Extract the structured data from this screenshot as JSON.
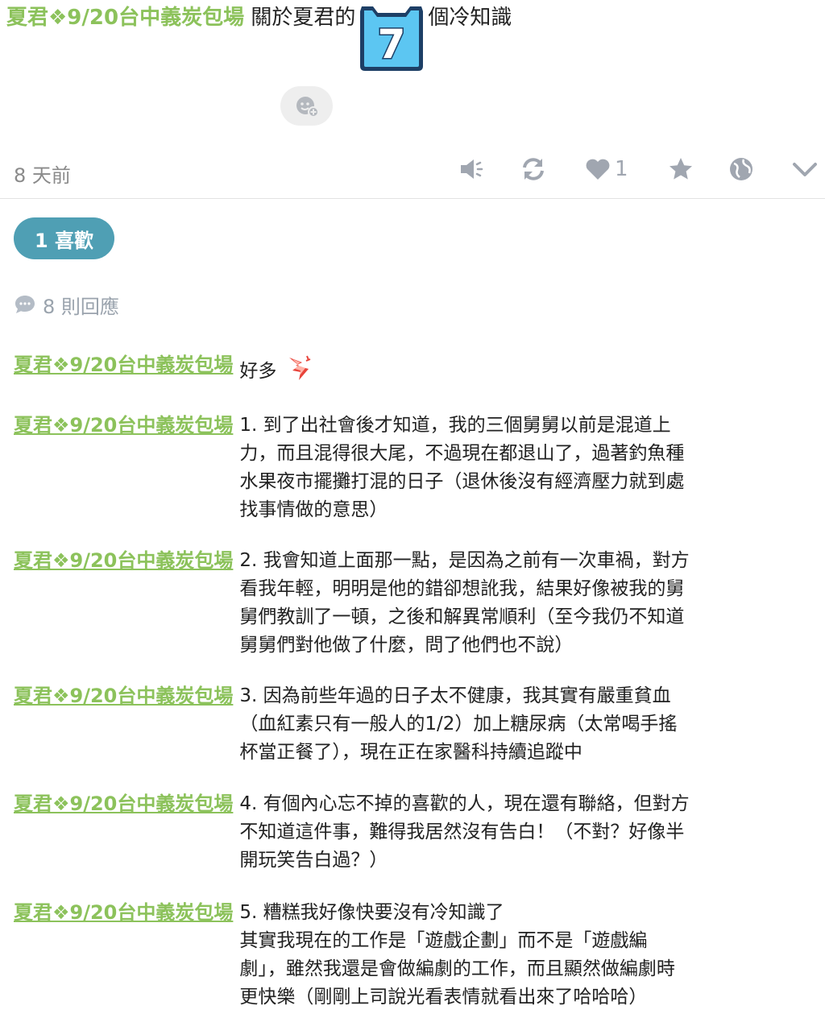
{
  "post": {
    "author": "夏君❖9/20台中義炭包場",
    "title_before": "關於夏君的",
    "title_badge": "7",
    "title_after": "個冷知識"
  },
  "meta": {
    "time": "8 天前",
    "like_count": "1"
  },
  "likes_pill": "1 喜歡",
  "replies": {
    "count_label": "8 則回應"
  },
  "comments": [
    {
      "author": "夏君❖9/20台中義炭包場",
      "text": "好多"
    },
    {
      "author": "夏君❖9/20台中義炭包場",
      "text": "1. 到了出社會後才知道，我的三個舅舅以前是混道上\n力，而且混得很大尾，不過現在都退山了，過著釣魚種\n水果夜市擺攤打混的日子（退休後沒有經濟壓力就到處\n找事情做的意思）"
    },
    {
      "author": "夏君❖9/20台中義炭包場",
      "text": "2. 我會知道上面那一點，是因為之前有一次車禍，對方\n看我年輕，明明是他的錯卻想訛我，結果好像被我的舅\n舅們教訓了一頓，之後和解異常順利（至今我仍不知道\n舅舅們對他做了什麼，問了他們也不說）"
    },
    {
      "author": "夏君❖9/20台中義炭包場",
      "text": "3. 因為前些年過的日子太不健康，我其實有嚴重貧血\n（血紅素只有一般人的1/2）加上糖尿病（太常喝手搖\n杯當正餐了），現在正在家醫科持續追蹤中"
    },
    {
      "author": "夏君❖9/20台中義炭包場",
      "text": "4. 有個內心忘不掉的喜歡的人，現在還有聯絡，但對方\n不知道這件事，難得我居然沒有告白！（不對？好像半\n開玩笑告白過？）"
    },
    {
      "author": "夏君❖9/20台中義炭包場",
      "text": "5. 糟糕我好像快要沒有冷知識了\n其實我現在的工作是「遊戲企劃」而不是「遊戲編\n劇」，雖然我還是會做編劇的工作，而且顯然做編劇時\n更快樂（剛剛上司說光看表情就看出來了哈哈哈）"
    }
  ],
  "icons": {
    "reaction": "add-reaction-icon",
    "mute": "speaker-icon",
    "repost": "refresh-icon",
    "like": "heart-icon",
    "favorite": "star-icon",
    "share": "globe-icon",
    "more": "chevron-down-icon",
    "replies": "chat-bubble-icon",
    "sticker": "sparkle-sticker-icon"
  },
  "colors": {
    "author_green": "#8cc25b",
    "pill_blue": "#4f9fb4",
    "icon_gray": "#a0a6b0",
    "badge_blue": "#56c3f0"
  }
}
